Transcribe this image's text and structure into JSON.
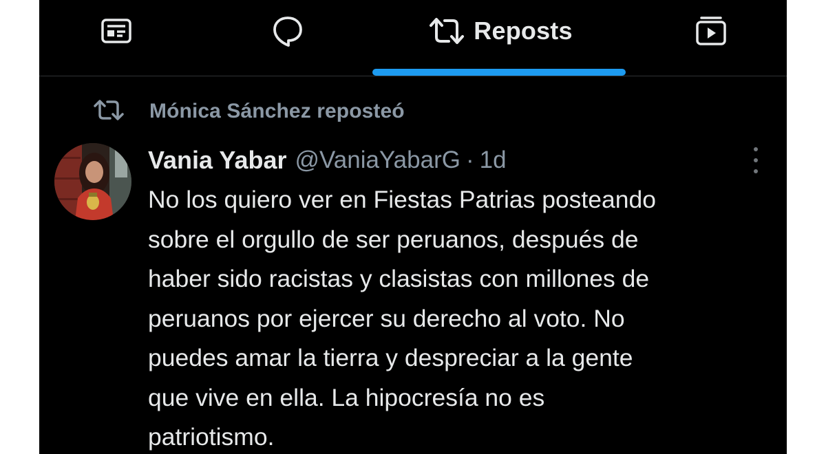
{
  "tabs": [
    {
      "name": "articles",
      "label": "",
      "icon": "article-icon"
    },
    {
      "name": "replies",
      "label": "",
      "icon": "reply-bubble-icon"
    },
    {
      "name": "reposts",
      "label": "Reposts",
      "icon": "repost-icon",
      "active": true
    },
    {
      "name": "media",
      "label": "",
      "icon": "video-icon"
    }
  ],
  "repost_context": {
    "label": "Mónica Sánchez reposteó",
    "icon": "repost-icon"
  },
  "tweet": {
    "author_name": "Vania Yabar",
    "handle": "@VaniaYabarG",
    "separator": "·",
    "time": "1d",
    "lines": [
      "No los quiero ver en Fiestas Patrias posteando",
      "sobre el orgullo de ser peruanos, después de",
      "haber sido racistas y clasistas con millones de",
      "peruanos por ejercer su derecho al voto. No",
      "puedes amar la tierra y despreciar a la gente",
      "que vive en ella. La hipocresía no es",
      "patriotismo."
    ]
  },
  "colors": {
    "background": "#000000",
    "text_primary": "#e7e9ea",
    "text_secondary": "#8b98a5",
    "accent": "#1d9bf0",
    "divider": "#2f3336"
  }
}
